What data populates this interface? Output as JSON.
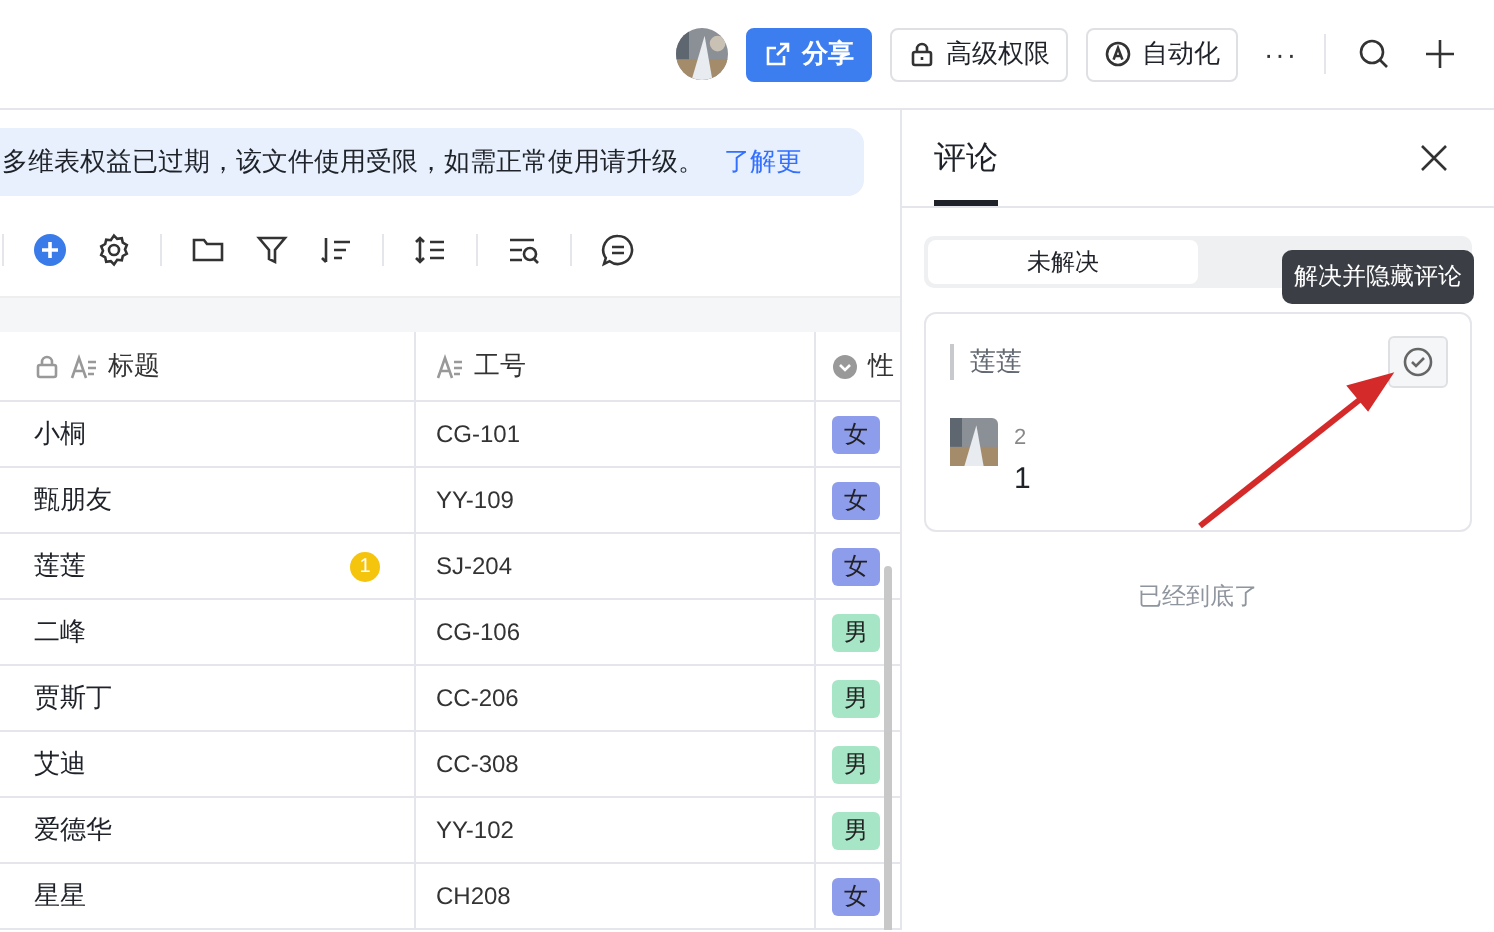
{
  "header": {
    "share_button": "分享",
    "permission_button": "高级权限",
    "automation_button": "自动化",
    "more_button": "···"
  },
  "banner": {
    "text": "多维表权益已过期，该文件使用受限，如需正常使用请升级。",
    "link": "了解更"
  },
  "table": {
    "columns": [
      {
        "label": "标题",
        "kind": "text",
        "locked": true
      },
      {
        "label": "工号",
        "kind": "text",
        "locked": false
      },
      {
        "label": "性",
        "kind": "option",
        "locked": false
      }
    ],
    "rows": [
      {
        "title": "小桐",
        "number": "CG-101",
        "gender": {
          "label": "女",
          "color": "#8e9cec"
        }
      },
      {
        "title": "甄朋友",
        "number": "YY-109",
        "gender": {
          "label": "女",
          "color": "#8e9cec"
        }
      },
      {
        "title": "莲莲",
        "number": "SJ-204",
        "gender": {
          "label": "女",
          "color": "#8e9cec"
        },
        "comment_count": "1"
      },
      {
        "title": "二峰",
        "number": "CG-106",
        "gender": {
          "label": "男",
          "color": "#a6e6c6"
        }
      },
      {
        "title": "贾斯丁",
        "number": "CC-206",
        "gender": {
          "label": "男",
          "color": "#a6e6c6"
        }
      },
      {
        "title": "艾迪",
        "number": "CC-308",
        "gender": {
          "label": "男",
          "color": "#a6e6c6"
        }
      },
      {
        "title": "爱德华",
        "number": "YY-102",
        "gender": {
          "label": "男",
          "color": "#a6e6c6"
        }
      },
      {
        "title": "星星",
        "number": "CH208",
        "gender": {
          "label": "女",
          "color": "#8e9cec"
        }
      }
    ]
  },
  "panel": {
    "tabs": [
      {
        "label": "评论",
        "selected": true
      }
    ],
    "filters": [
      {
        "label": "未解决",
        "selected": true
      }
    ],
    "tooltip": "解决并隐藏评论",
    "comments": [
      {
        "quote": "莲莲",
        "author": "2",
        "text": "1"
      }
    ],
    "end_text": "已经到底了"
  }
}
